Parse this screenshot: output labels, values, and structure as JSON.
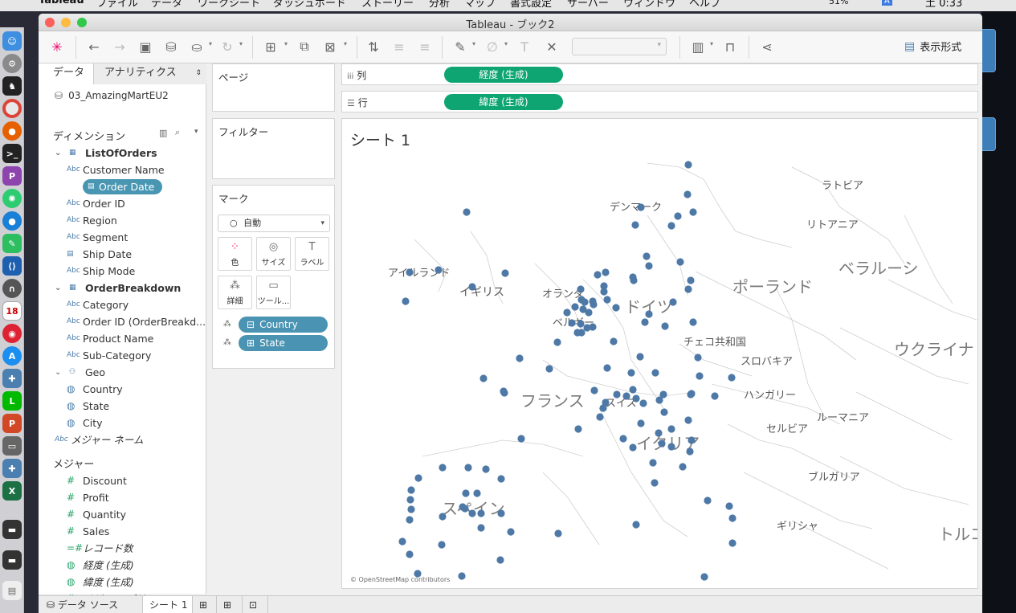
{
  "menubar": {
    "app": "Tableau",
    "items": [
      "ファイル",
      "データ",
      "ワークシート",
      "ダッシュボード",
      "ストーリー",
      "分析",
      "マップ",
      "書式設定",
      "サーバー",
      "ウィンドウ",
      "ヘルプ"
    ],
    "battery": "51%",
    "input": "A",
    "clock": "土 0:33"
  },
  "window": {
    "title": "Tableau - ブック2"
  },
  "toolbar": {
    "show_me": "表示形式"
  },
  "data_pane": {
    "tab_data": "データ",
    "tab_analytics": "アナリティクス",
    "datasource": "03_AmazingMartEU2",
    "dimensions_label": "ディメンション",
    "measures_label": "メジャー",
    "dimensions": [
      {
        "kind": "table",
        "label": "ListOfOrders"
      },
      {
        "kind": "abc",
        "label": "Customer Name"
      },
      {
        "kind": "date",
        "label": "Order Date",
        "selected": true
      },
      {
        "kind": "abc",
        "label": "Order ID"
      },
      {
        "kind": "abc",
        "label": "Region"
      },
      {
        "kind": "abc",
        "label": "Segment"
      },
      {
        "kind": "date",
        "label": "Ship Date"
      },
      {
        "kind": "abc",
        "label": "Ship Mode"
      },
      {
        "kind": "table",
        "label": "OrderBreakdown"
      },
      {
        "kind": "abc",
        "label": "Category"
      },
      {
        "kind": "abc",
        "label": "Order ID (OrderBreakd..."
      },
      {
        "kind": "abc",
        "label": "Product Name"
      },
      {
        "kind": "abc",
        "label": "Sub-Category"
      },
      {
        "kind": "hier",
        "label": "Geo"
      },
      {
        "kind": "geo",
        "label": "Country"
      },
      {
        "kind": "geo",
        "label": "State"
      },
      {
        "kind": "geo",
        "label": "City"
      },
      {
        "kind": "abc0",
        "label": "メジャー ネーム"
      }
    ],
    "measures": [
      {
        "kind": "num",
        "label": "Discount"
      },
      {
        "kind": "num",
        "label": "Profit"
      },
      {
        "kind": "num",
        "label": "Quantity"
      },
      {
        "kind": "num",
        "label": "Sales"
      },
      {
        "kind": "num2",
        "label": "レコード数"
      },
      {
        "kind": "geo",
        "label": "経度 (生成)"
      },
      {
        "kind": "geo",
        "label": "緯度 (生成)"
      },
      {
        "kind": "num",
        "label": "メジャー バリュー"
      }
    ]
  },
  "cards": {
    "pages": "ページ",
    "filters": "フィルター",
    "marks": "マーク",
    "mark_type": "自動",
    "buttons": [
      "色",
      "サイズ",
      "ラベル",
      "詳細",
      "ツール..."
    ],
    "pills": [
      "Country",
      "State"
    ]
  },
  "shelves": {
    "columns_label": "列",
    "columns_pill": "経度 (生成)",
    "rows_label": "行",
    "rows_pill": "緯度 (生成)"
  },
  "viz": {
    "title": "シート 1",
    "credit": "© OpenStreetMap contributors",
    "dot_color": "#4e79a7",
    "country_labels": [
      "ラトビア",
      "デンマーク",
      "リトアニア",
      "アイルランド",
      "イギリス",
      "ポーランド",
      "ベラルーシ",
      "オランダ",
      "ドイツ",
      "ベルギー",
      "チェコ共和国",
      "ウクライナ",
      "スロバキア",
      "フランス",
      "スイス",
      "ハンガリー",
      "ルーマニア",
      "イタリア",
      "セルビア",
      "ブルガリア",
      "スペイン",
      "ギリシャ",
      "トルコ"
    ]
  },
  "bottom_tabs": {
    "datasource": "データ ソース",
    "sheet": "シート 1"
  }
}
